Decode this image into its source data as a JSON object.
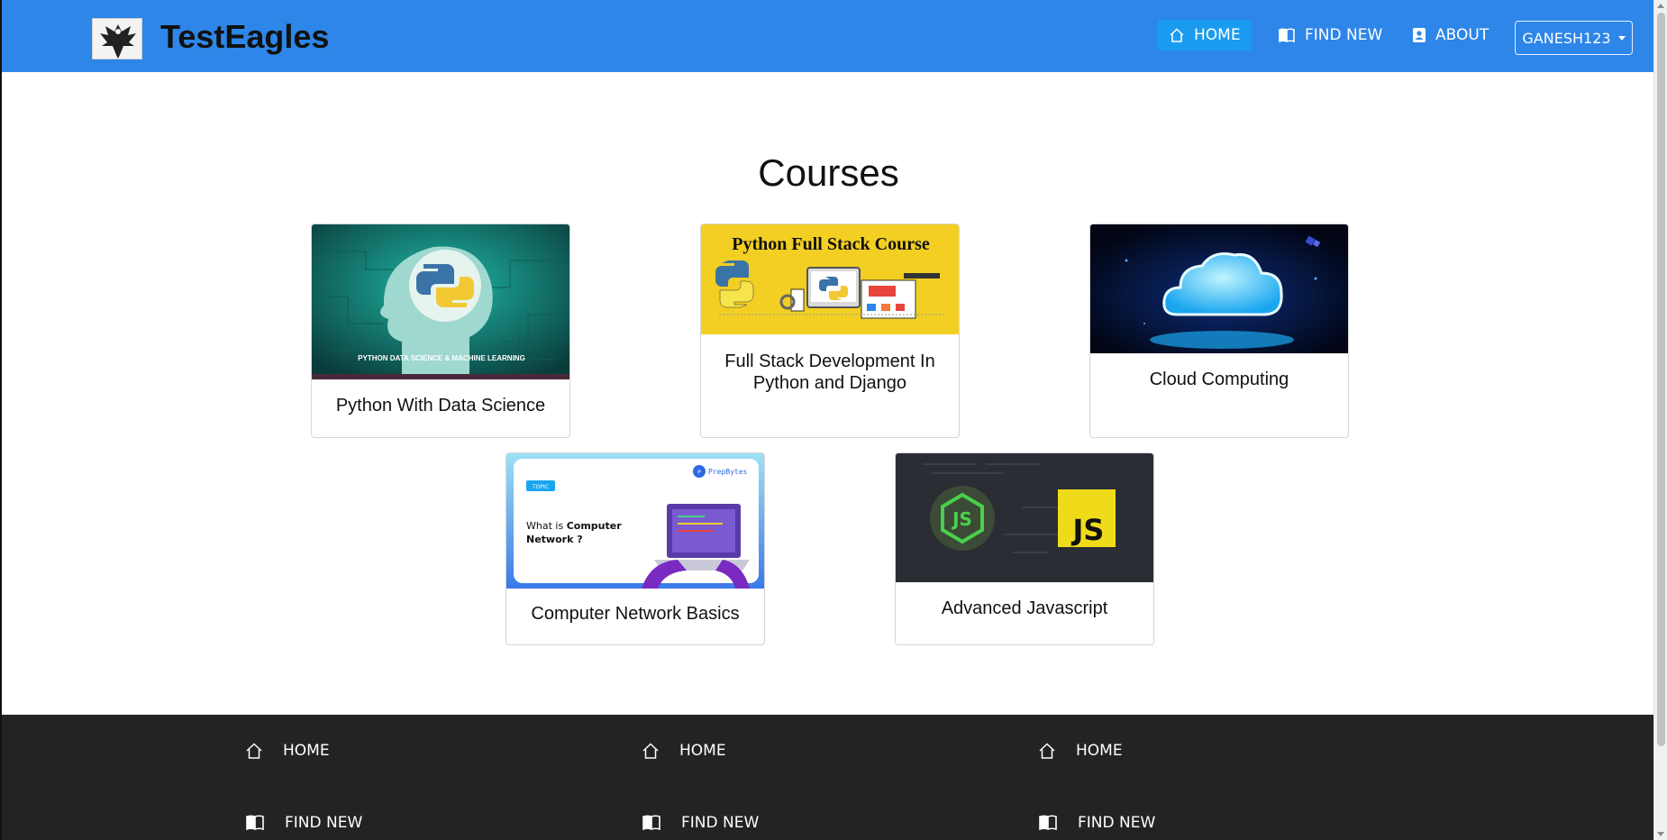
{
  "brand": {
    "name": "TestEagles",
    "logo_icon": "eagle-logo-icon"
  },
  "nav": {
    "items": [
      {
        "label": "HOME",
        "icon": "home-icon",
        "active": true
      },
      {
        "label": "FIND NEW",
        "icon": "book-icon",
        "active": false
      },
      {
        "label": "ABOUT",
        "icon": "contact-icon",
        "active": false
      }
    ],
    "user": {
      "label": "GANESH123"
    }
  },
  "main": {
    "heading": "Courses",
    "courses": [
      {
        "title": "Python With Data Science",
        "image_text": "PYTHON DATA SCIENCE & MACHINE LEARNING"
      },
      {
        "title": "Full Stack Development In Python and Django",
        "image_text": "Python Full Stack Course"
      },
      {
        "title": "Cloud Computing"
      },
      {
        "title": "Computer Network Basics",
        "image_tag": "TOPIC",
        "image_text_1": "What is ",
        "image_text_2": "Computer",
        "image_text_3": "Network ?",
        "image_brand": "PrepBytes"
      },
      {
        "title": "Advanced Javascript",
        "image_text": "JS"
      }
    ]
  },
  "footer": {
    "columns": [
      {
        "items": [
          {
            "label": "HOME",
            "icon": "home-icon"
          },
          {
            "label": "FIND NEW",
            "icon": "book-icon"
          }
        ]
      },
      {
        "items": [
          {
            "label": "HOME",
            "icon": "home-icon"
          },
          {
            "label": "FIND NEW",
            "icon": "book-icon"
          }
        ]
      },
      {
        "items": [
          {
            "label": "HOME",
            "icon": "home-icon"
          },
          {
            "label": "FIND NEW",
            "icon": "book-icon"
          }
        ]
      }
    ]
  },
  "colors": {
    "navbar": "#2d86e8",
    "active_nav": "#1a9bf0",
    "footer": "#232323"
  }
}
